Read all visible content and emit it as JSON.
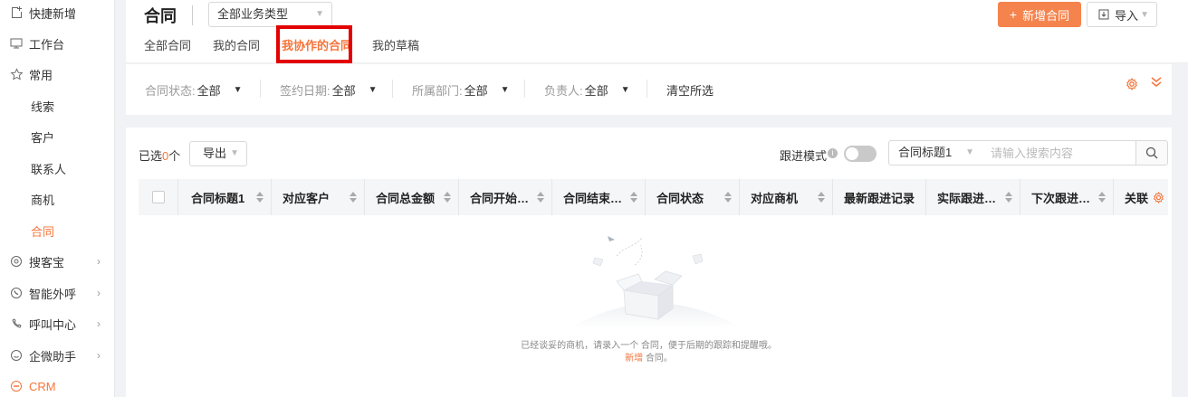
{
  "sidebar": {
    "items": [
      {
        "label": "快捷新增",
        "icon": "quick-add-icon"
      },
      {
        "label": "工作台",
        "icon": "monitor-icon"
      },
      {
        "label": "常用",
        "icon": "star-icon"
      },
      {
        "label": "线索"
      },
      {
        "label": "客户"
      },
      {
        "label": "联系人"
      },
      {
        "label": "商机"
      },
      {
        "label": "合同"
      },
      {
        "label": "搜客宝",
        "icon": "search-treasure-icon",
        "chevron": "›"
      },
      {
        "label": "智能外呼",
        "icon": "phone-icon",
        "chevron": "›"
      },
      {
        "label": "呼叫中心",
        "icon": "call-center-icon",
        "chevron": "›"
      },
      {
        "label": "企微助手",
        "icon": "wecom-icon",
        "chevron": "›"
      },
      {
        "label": "CRM",
        "icon": "crm-icon"
      }
    ],
    "active_item": "合同"
  },
  "header": {
    "title": "合同",
    "business_type": "全部业务类型",
    "tabs": [
      {
        "label": "全部合同"
      },
      {
        "label": "我的合同"
      },
      {
        "label": "我协作的合同"
      },
      {
        "label": "我的草稿"
      }
    ],
    "active_tab": "我协作的合同",
    "add_button": "新增合同",
    "import_button": "导入"
  },
  "filters": {
    "items": [
      {
        "label": "合同状态:",
        "value": "全部"
      },
      {
        "label": "签约日期:",
        "value": "全部"
      },
      {
        "label": "所属部门:",
        "value": "全部"
      },
      {
        "label": "负责人:",
        "value": "全部"
      }
    ],
    "clear_label": "清空所选"
  },
  "toolbar": {
    "selected_prefix": "已选",
    "selected_count": "0",
    "selected_suffix": "个",
    "export_button": "导出",
    "follow_mode_label": "跟进模式",
    "follow_mode_on": false,
    "search_field": "合同标题1",
    "search_placeholder": "请输入搜索内容"
  },
  "table": {
    "columns": [
      "合同标题1",
      "对应客户",
      "合同总金额",
      "合同开始…",
      "合同结束…",
      "合同状态",
      "对应商机",
      "最新跟进记录",
      "实际跟进…",
      "下次跟进…",
      "关联"
    ],
    "rows": []
  },
  "empty_state": {
    "line1": "已经谈妥的商机，请录入一个 合同，便于后期的跟踪和提醒哦。",
    "link": "新增",
    "line2_suffix": " 合同。"
  },
  "colors": {
    "accent": "#f5753b",
    "primary_button": "#f5834d",
    "highlight_box": "#e30000"
  }
}
